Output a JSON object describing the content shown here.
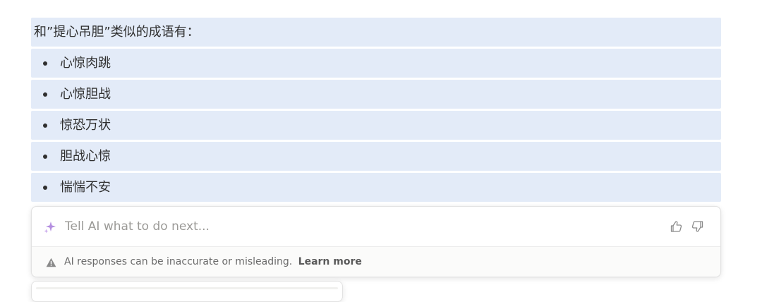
{
  "response": {
    "heading": "和”提心吊胆”类似的成语有：",
    "items": [
      {
        "label": "心惊肉跳"
      },
      {
        "label": "心惊胆战"
      },
      {
        "label": "惊恐万状"
      },
      {
        "label": "胆战心惊"
      },
      {
        "label": "惴惴不安"
      }
    ]
  },
  "ai_prompt": {
    "placeholder": "Tell AI what to do next...",
    "sparkle_icon": "sparkle-icon",
    "thumbs_up_icon": "thumbs-up-icon",
    "thumbs_down_icon": "thumbs-down-icon",
    "accent_color": "#b48ee0"
  },
  "footer": {
    "warning_icon": "warning-icon",
    "disclaimer": "AI responses can be inaccurate or misleading.",
    "learn_more": "Learn more"
  },
  "colors": {
    "selection_highlight": "#e3ebf8"
  }
}
